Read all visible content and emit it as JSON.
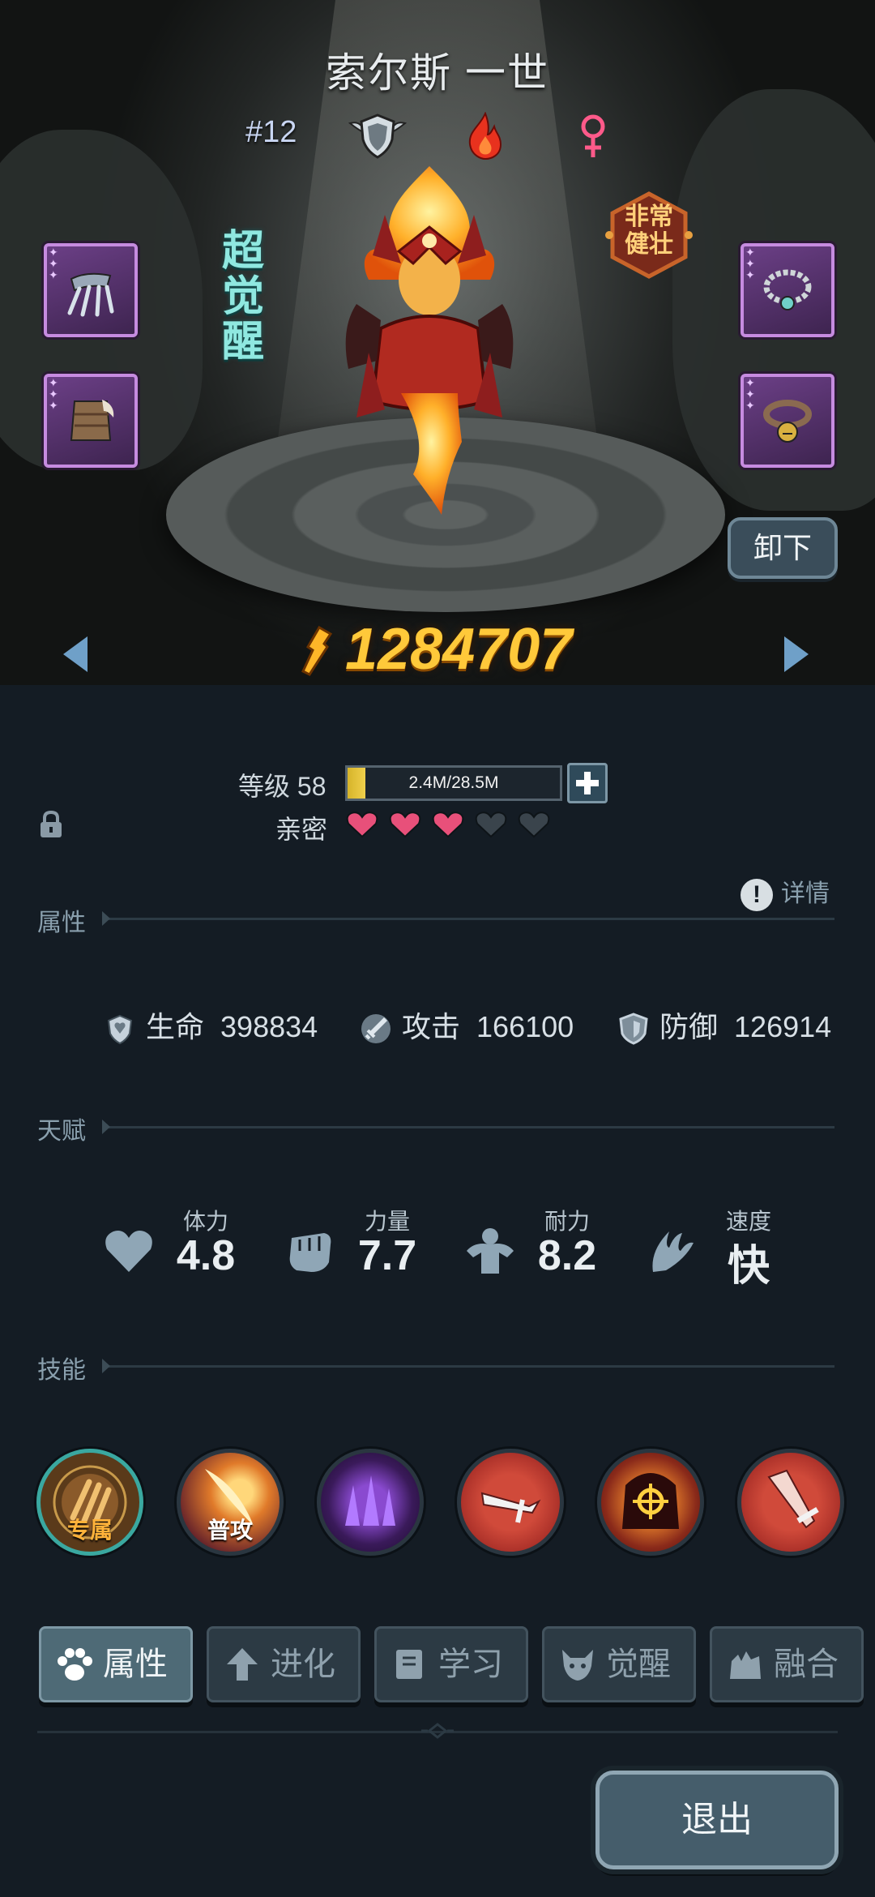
{
  "hero": {
    "name": "索尔斯 一世",
    "rank": "#12",
    "class_icon": "shield-wings-icon",
    "element_icon": "fire-icon",
    "gender_icon": "female-icon",
    "awaken_tag": "超觉醒",
    "trait_badge": "非常健壮",
    "power": "1284707",
    "unequip_label": "卸下"
  },
  "equipment": {
    "left": [
      "claw-weapon-icon",
      "fur-armor-icon"
    ],
    "right": [
      "bead-necklace-icon",
      "bell-collar-icon"
    ]
  },
  "progress": {
    "level_label": "等级 58",
    "xp_text": "2.4M/28.5M",
    "xp_fraction": 0.084,
    "intimacy_label": "亲密",
    "intimacy_filled": 3,
    "intimacy_total": 5
  },
  "sections": {
    "attributes": "属性",
    "talent": "天赋",
    "skills": "技能",
    "details": "详情"
  },
  "stats": [
    {
      "icon": "heart-shield-icon",
      "label": "生命",
      "value": "398834"
    },
    {
      "icon": "sword-icon",
      "label": "攻击",
      "value": "166100"
    },
    {
      "icon": "shield-icon",
      "label": "防御",
      "value": "126914"
    }
  ],
  "talents": [
    {
      "icon": "heart-icon",
      "label": "体力",
      "value": "4.8"
    },
    {
      "icon": "fist-icon",
      "label": "力量",
      "value": "7.7"
    },
    {
      "icon": "muscle-icon",
      "label": "耐力",
      "value": "8.2"
    },
    {
      "icon": "wing-icon",
      "label": "速度",
      "value": "快"
    }
  ],
  "skills": [
    {
      "name": "exclusive-skill",
      "label": "专属"
    },
    {
      "name": "basic-attack-skill",
      "label": "普攻"
    },
    {
      "name": "shadow-spikes-skill",
      "label": ""
    },
    {
      "name": "sword-strike-skill",
      "label": ""
    },
    {
      "name": "target-lock-skill",
      "label": ""
    },
    {
      "name": "crystal-blade-skill",
      "label": ""
    }
  ],
  "tabs": [
    {
      "label": "属性",
      "icon": "paw-icon",
      "active": true
    },
    {
      "label": "进化",
      "icon": "up-arrow-icon",
      "active": false
    },
    {
      "label": "学习",
      "icon": "book-icon",
      "active": false
    },
    {
      "label": "觉醒",
      "icon": "demon-head-icon",
      "active": false
    },
    {
      "label": "融合",
      "icon": "fusion-icon",
      "active": false
    }
  ],
  "exit_label": "退出",
  "colors": {
    "power": "#ffc93a",
    "heart_filled": "#e8507a",
    "heart_empty": "#3a444c",
    "xp_fill": "#e0c03a",
    "equip_border": "#c68be0"
  }
}
